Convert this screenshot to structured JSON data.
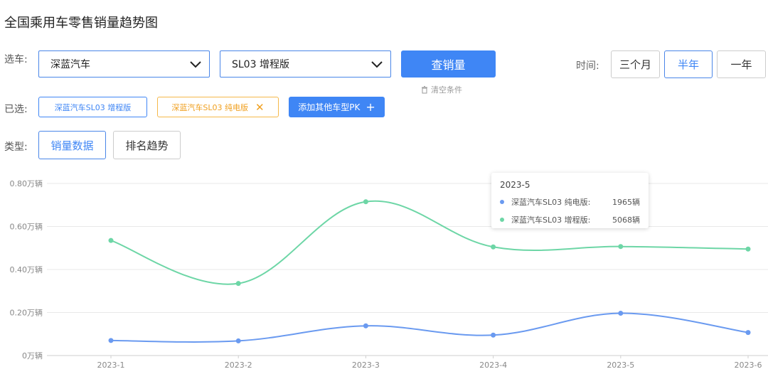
{
  "title": "全国乘用车零售销量趋势图",
  "filters": {
    "select_label": "选车:",
    "brand": "深蓝汽车",
    "model": "SL03 增程版",
    "query_button": "查销量",
    "clear_label": "清空条件",
    "time_label": "时间:",
    "time_options": [
      "三个月",
      "半年",
      "一年"
    ],
    "time_selected": "半年"
  },
  "selected": {
    "label": "已选:",
    "tags": [
      "深蓝汽车SL03 增程版",
      "深蓝汽车SL03 纯电版"
    ],
    "add_label": "添加其他车型PK"
  },
  "type": {
    "label": "类型:",
    "options": [
      "销量数据",
      "排名趋势"
    ],
    "selected": "销量数据"
  },
  "colors": {
    "primary": "#3f86f5",
    "series_green": "#6dd6a6",
    "series_blue": "#6a9af0",
    "tag_orange": "#f0a020"
  },
  "chart_data": {
    "type": "line",
    "categories": [
      "2023-1",
      "2023-2",
      "2023-3",
      "2023-4",
      "2023-5",
      "2023-6"
    ],
    "y_ticks": [
      "0万辆",
      "0.20万辆",
      "0.40万辆",
      "0.60万辆",
      "0.80万辆"
    ],
    "ylim": [
      0,
      0.8
    ],
    "series": [
      {
        "name": "深蓝汽车SL03 纯电版",
        "color": "#6a9af0",
        "values": [
          0.07,
          0.068,
          0.138,
          0.095,
          0.1965,
          0.107
        ]
      },
      {
        "name": "深蓝汽车SL03 增程版",
        "color": "#6dd6a6",
        "values": [
          0.535,
          0.335,
          0.715,
          0.505,
          0.5068,
          0.495
        ]
      }
    ],
    "grid": true,
    "tooltip": {
      "title": "2023-5",
      "rows": [
        {
          "name": "深蓝汽车SL03 纯电版:",
          "value": "1965辆",
          "color": "#6a9af0"
        },
        {
          "name": "深蓝汽车SL03 增程版:",
          "value": "5068辆",
          "color": "#6dd6a6"
        }
      ]
    }
  }
}
